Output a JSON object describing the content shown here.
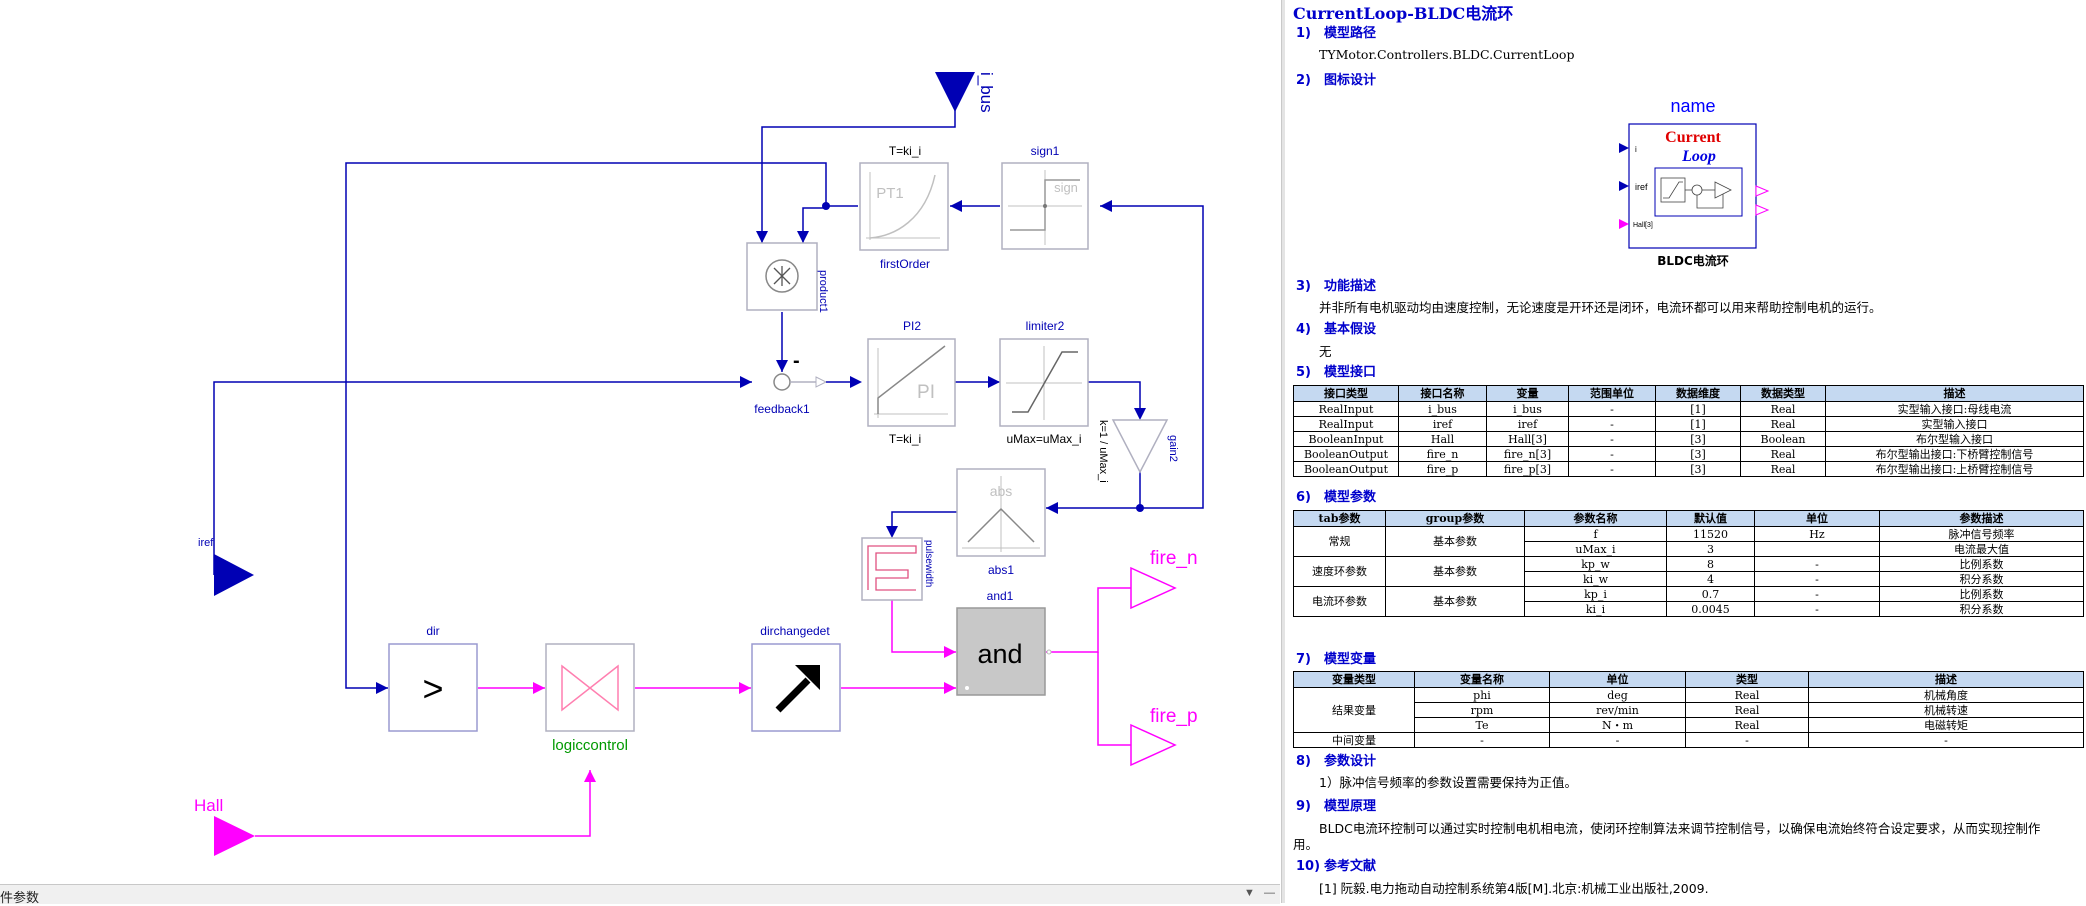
{
  "diagram": {
    "inputs": {
      "i_bus": "i_bus",
      "iref": "iref",
      "hall": "Hall"
    },
    "outputs": {
      "fire_n": "fire_n",
      "fire_p": "fire_p"
    },
    "blocks": {
      "firstOrder": {
        "top": "T=ki_i",
        "inner": "PT1",
        "name": "firstOrder"
      },
      "sign1": {
        "name": "sign1",
        "inner": "sign"
      },
      "product1": {
        "name": "product1"
      },
      "feedback1": {
        "name": "feedback1",
        "minus": "-"
      },
      "pi2": {
        "name": "PI2",
        "inner": "PI",
        "param": "T=ki_i"
      },
      "limiter2": {
        "name": "limiter2",
        "param": "uMax=uMax_i"
      },
      "gain2": {
        "name": "gain2",
        "param": "k=1 / uMax_i"
      },
      "abs1": {
        "name": "abs1",
        "inner": "abs"
      },
      "pulsewidth": {
        "name": "pulsewidth"
      },
      "and1": {
        "name": "and1",
        "inner": "and"
      },
      "dir": {
        "name": "dir",
        "inner": ">"
      },
      "logiccontrol": {
        "name": "logiccontrol"
      },
      "dirchangedet": {
        "name": "dirchangedet"
      }
    }
  },
  "bottom_bar": {
    "label": "件参数"
  },
  "colors": {
    "blue": "#0000b4",
    "magenta": "#ff00ff",
    "green": "#009900",
    "gray": "#b0b0c0",
    "title_blue": "#0000cc",
    "header_bg": "#c5d9f1"
  },
  "doc": {
    "title": "CurrentLoop-BLDC电流环",
    "s1": {
      "num": "1)",
      "title": "模型路径",
      "text": "TYMotor.Controllers.BLDC.CurrentLoop"
    },
    "s2": {
      "num": "2)",
      "title": "图标设计",
      "icon_name": "name",
      "icon_word1": "Current",
      "icon_word2": "Loop",
      "port_i": "i",
      "port_iref": "iref",
      "port_hall": "Hall[3]",
      "caption": "BLDC电流环"
    },
    "s3": {
      "num": "3)",
      "title": "功能描述",
      "text": "并非所有电机驱动均由速度控制，无论速度是开环还是闭环，电流环都可以用来帮助控制电机的运行。"
    },
    "s4": {
      "num": "4)",
      "title": "基本假设",
      "text": "无"
    },
    "s5": {
      "num": "5)",
      "title": "模型接口",
      "headers": [
        "接口类型",
        "接口名称",
        "变量",
        "范围单位",
        "数据维度",
        "数据类型",
        "描述"
      ],
      "rows": [
        [
          "RealInput",
          "i_bus",
          "i_bus",
          "-",
          "[1]",
          "Real",
          "实型输入接口:母线电流"
        ],
        [
          "RealInput",
          "iref",
          "iref",
          "-",
          "[1]",
          "Real",
          "实型输入接口"
        ],
        [
          "BooleanInput",
          "Hall",
          "Hall[3]",
          "-",
          "[3]",
          "Boolean",
          "布尔型输入接口"
        ],
        [
          "BooleanOutput",
          "fire_n",
          "fire_n[3]",
          "-",
          "[3]",
          "Real",
          "布尔型输出接口:下桥臂控制信号"
        ],
        [
          "BooleanOutput",
          "fire_p",
          "fire_p[3]",
          "-",
          "[3]",
          "Real",
          "布尔型输出接口:上桥臂控制信号"
        ]
      ]
    },
    "s6": {
      "num": "6)",
      "title": "模型参数",
      "headers": [
        "tab参数",
        "group参数",
        "参数名称",
        "默认值",
        "单位",
        "参数描述"
      ],
      "groups": [
        {
          "tab": "常规",
          "group": "基本参数",
          "rows": [
            [
              "f",
              "11520",
              "Hz",
              "脉冲信号频率"
            ],
            [
              "uMax_i",
              "3",
              "",
              "电流最大值"
            ]
          ]
        },
        {
          "tab": "速度环参数",
          "group": "基本参数",
          "rows": [
            [
              "kp_w",
              "8",
              "-",
              "比例系数"
            ],
            [
              "ki_w",
              "4",
              "-",
              "积分系数"
            ]
          ]
        },
        {
          "tab": "电流环参数",
          "group": "基本参数",
          "rows": [
            [
              "kp_i",
              "0.7",
              "-",
              "比例系数"
            ],
            [
              "ki_i",
              "0.0045",
              "-",
              "积分系数"
            ]
          ]
        }
      ]
    },
    "s7": {
      "num": "7)",
      "title": "模型变量",
      "headers": [
        "变量类型",
        "变量名称",
        "单位",
        "类型",
        "描述"
      ],
      "group1": "结果变量",
      "rows": [
        [
          "phi",
          "deg",
          "Real",
          "机械角度"
        ],
        [
          "rpm",
          "rev/min",
          "Real",
          "机械转速"
        ],
        [
          "Te",
          "N・m",
          "Real",
          "电磁转矩"
        ]
      ],
      "group2": "中间变量",
      "row2": [
        "-",
        "-",
        "-",
        "-"
      ]
    },
    "s8": {
      "num": "8)",
      "title": "参数设计",
      "text": "1）脉冲信号频率的参数设置需要保持为正值。"
    },
    "s9": {
      "num": "9)",
      "title": "模型原理",
      "text1": "BLDC电流环控制可以通过实时控制电机相电流，使闭环控制算法来调节控制信号，以确保电流始终符合设定要求，从而实现控制作",
      "text2": "用。"
    },
    "s10": {
      "num": "10)",
      "title": "参考文献",
      "text": "[1]  阮毅.电力拖动自动控制系统第4版[M].北京:机械工业出版社,2009."
    }
  }
}
